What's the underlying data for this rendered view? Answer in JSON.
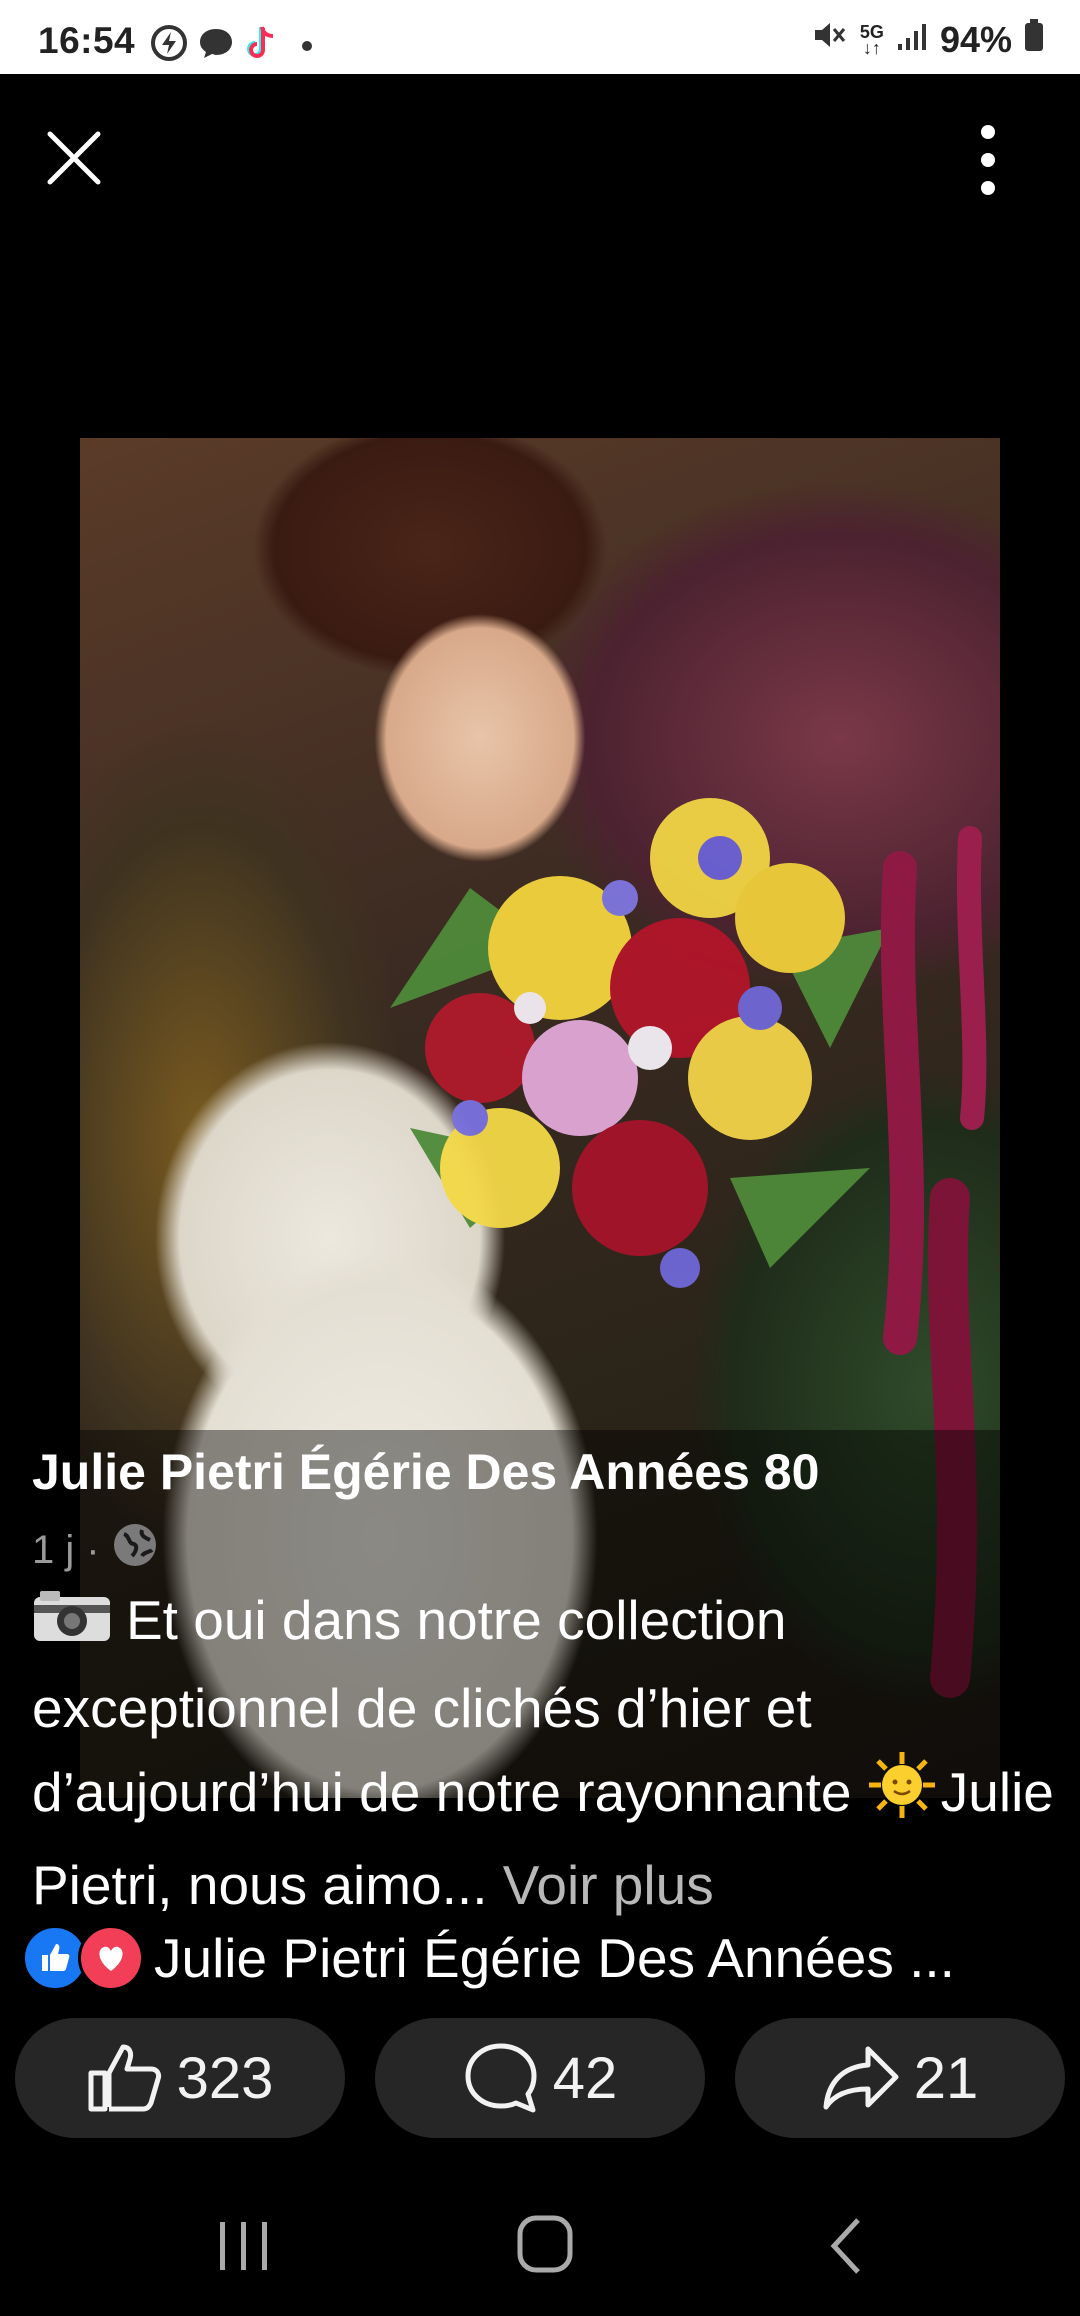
{
  "status_bar": {
    "time": "16:54",
    "battery": "94%",
    "network": "5G",
    "icons_left": [
      "data-saver-icon",
      "chat-bubble-icon",
      "tiktok-icon",
      "dot-icon"
    ],
    "icons_right": [
      "mute-icon",
      "network-5g-icon",
      "signal-icon",
      "battery-icon"
    ]
  },
  "viewer": {
    "close_icon": "close-icon",
    "more_icon": "more-vertical-icon"
  },
  "post": {
    "page_name": "Julie Pietri Égérie Des Années 80",
    "time_ago": "1 j",
    "privacy_icon": "globe-icon",
    "text_line1": "Et oui dans notre collection exceptionnel de clichés d’hier et d’aujourd’hui de notre rayonnante ",
    "text_line2": "Julie Pietri, nous aimo...",
    "see_more": " Voir plus",
    "reactions_names": "Julie Pietri Égérie Des Années ..."
  },
  "actions": {
    "likes": "323",
    "comments": "42",
    "shares": "21"
  },
  "colors": {
    "like_blue": "#1877f2",
    "love_red": "#f33e58",
    "button_bg": "#262626"
  }
}
